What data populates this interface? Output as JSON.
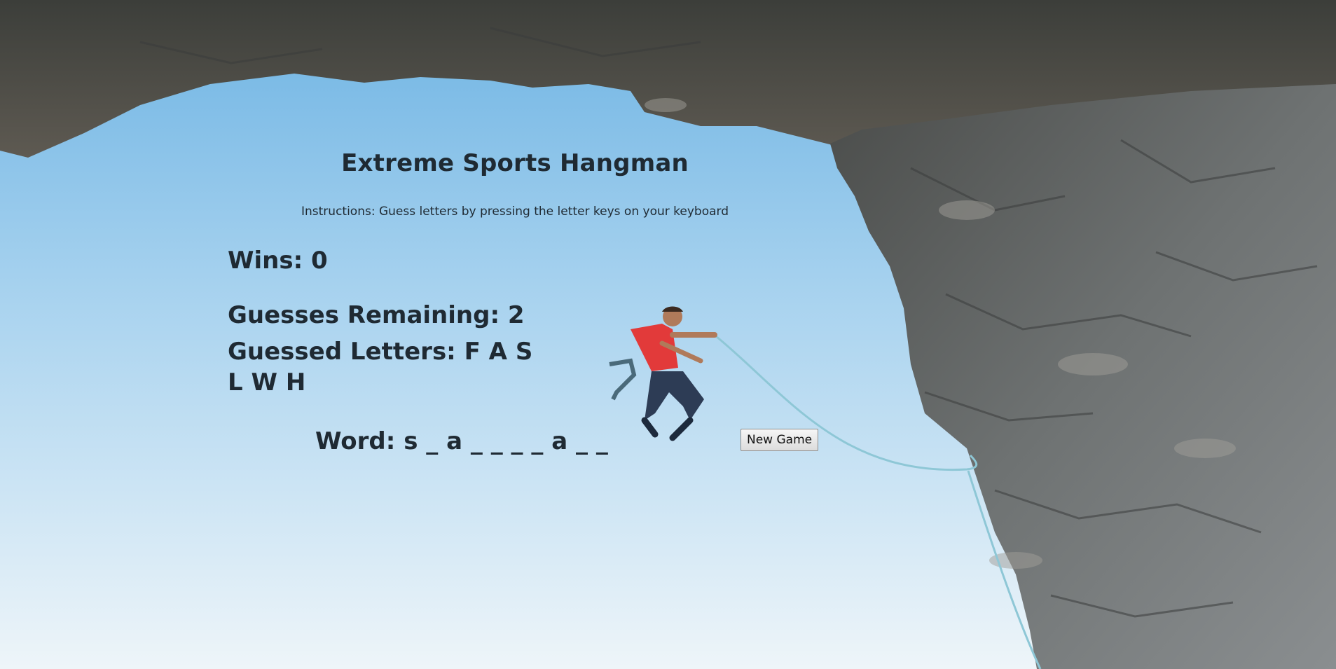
{
  "game": {
    "title": "Extreme Sports Hangman",
    "instructions": "Instructions: Guess letters by pressing the letter keys on your keyboard",
    "wins_label": "Wins: 0",
    "remaining_label": "Guesses Remaining: 2",
    "guessed_label": "Guessed Letters: F A S L W H",
    "word_label": "Word: s _ a _ _ _ _ a _ _",
    "new_game_label": "New Game"
  },
  "colors": {
    "sky_top": "#7fbde6",
    "sky_bottom": "#eaf3f8",
    "rock": "#5c5f60",
    "text": "#1f2a33"
  },
  "scene": {
    "background_icon": "rock-climber-photo"
  }
}
